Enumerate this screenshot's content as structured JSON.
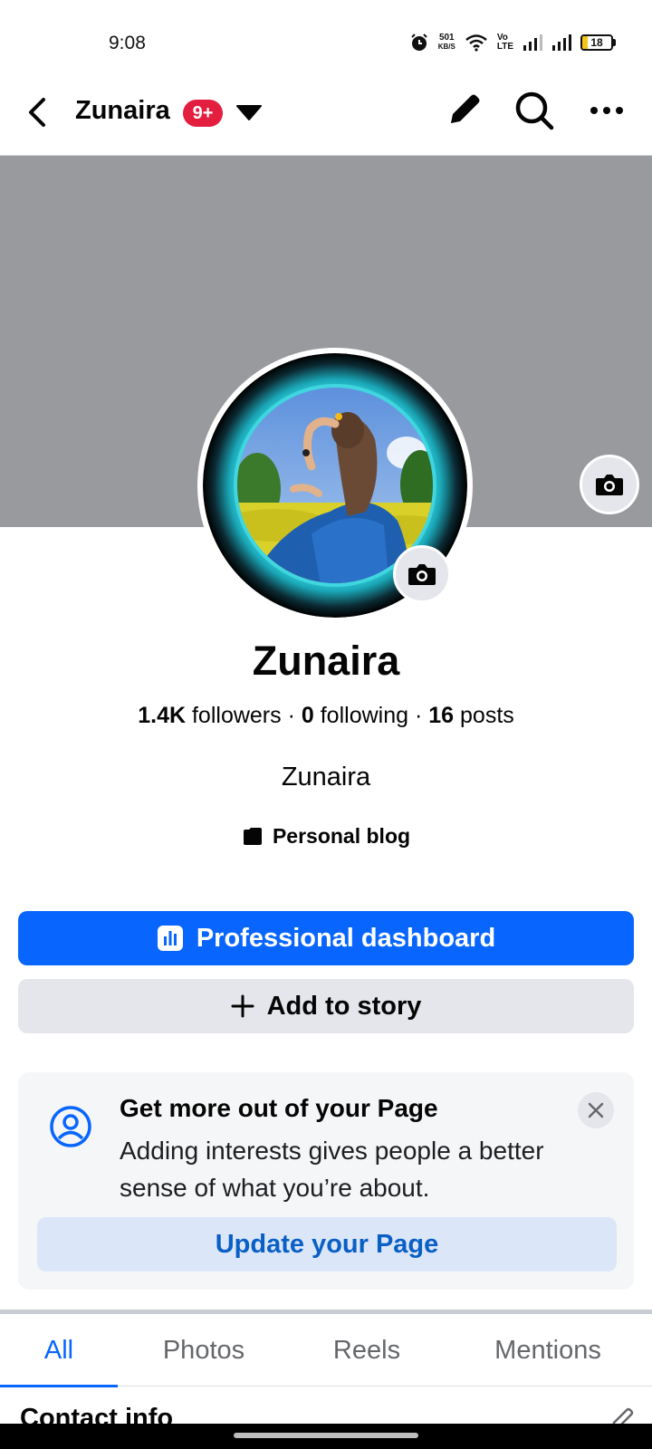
{
  "status_bar": {
    "time": "9:08",
    "net_speed_value": "501",
    "net_speed_unit": "KB/S",
    "volte_top": "Vo",
    "volte_bottom": "LTE",
    "battery_level": "18",
    "icons": [
      "alarm-icon",
      "wifi-icon",
      "signal-icon",
      "signal-icon",
      "battery-icon"
    ]
  },
  "header": {
    "page_name": "Zunaira",
    "notification_badge": "9+",
    "icons": [
      "back-arrow-icon",
      "caret-down-icon",
      "pencil-icon",
      "search-icon",
      "more-dots-icon"
    ]
  },
  "profile": {
    "name": "Zunaira",
    "followers_count": "1.4K",
    "followers_label": "followers",
    "following_count": "0",
    "following_label": "following",
    "posts_count": "16",
    "posts_label": "posts",
    "separator": "·",
    "bio": "Zunaira",
    "category": "Personal blog"
  },
  "actions": {
    "primary_label": "Professional dashboard",
    "secondary_label": "Add to story"
  },
  "prompt": {
    "title": "Get more out of your Page",
    "body": "Adding interests gives people a better sense of what you’re about.",
    "button_label": "Update your Page"
  },
  "tabs": [
    {
      "label": "All",
      "active": true
    },
    {
      "label": "Photos",
      "active": false
    },
    {
      "label": "Reels",
      "active": false
    },
    {
      "label": "Mentions",
      "active": false
    }
  ],
  "section_peek": {
    "title": "Contact info"
  },
  "colors": {
    "accent": "#0866ff",
    "badge": "#e41e3f",
    "cover": "#989a9e",
    "avatar_ring": "#3fd6e0"
  }
}
